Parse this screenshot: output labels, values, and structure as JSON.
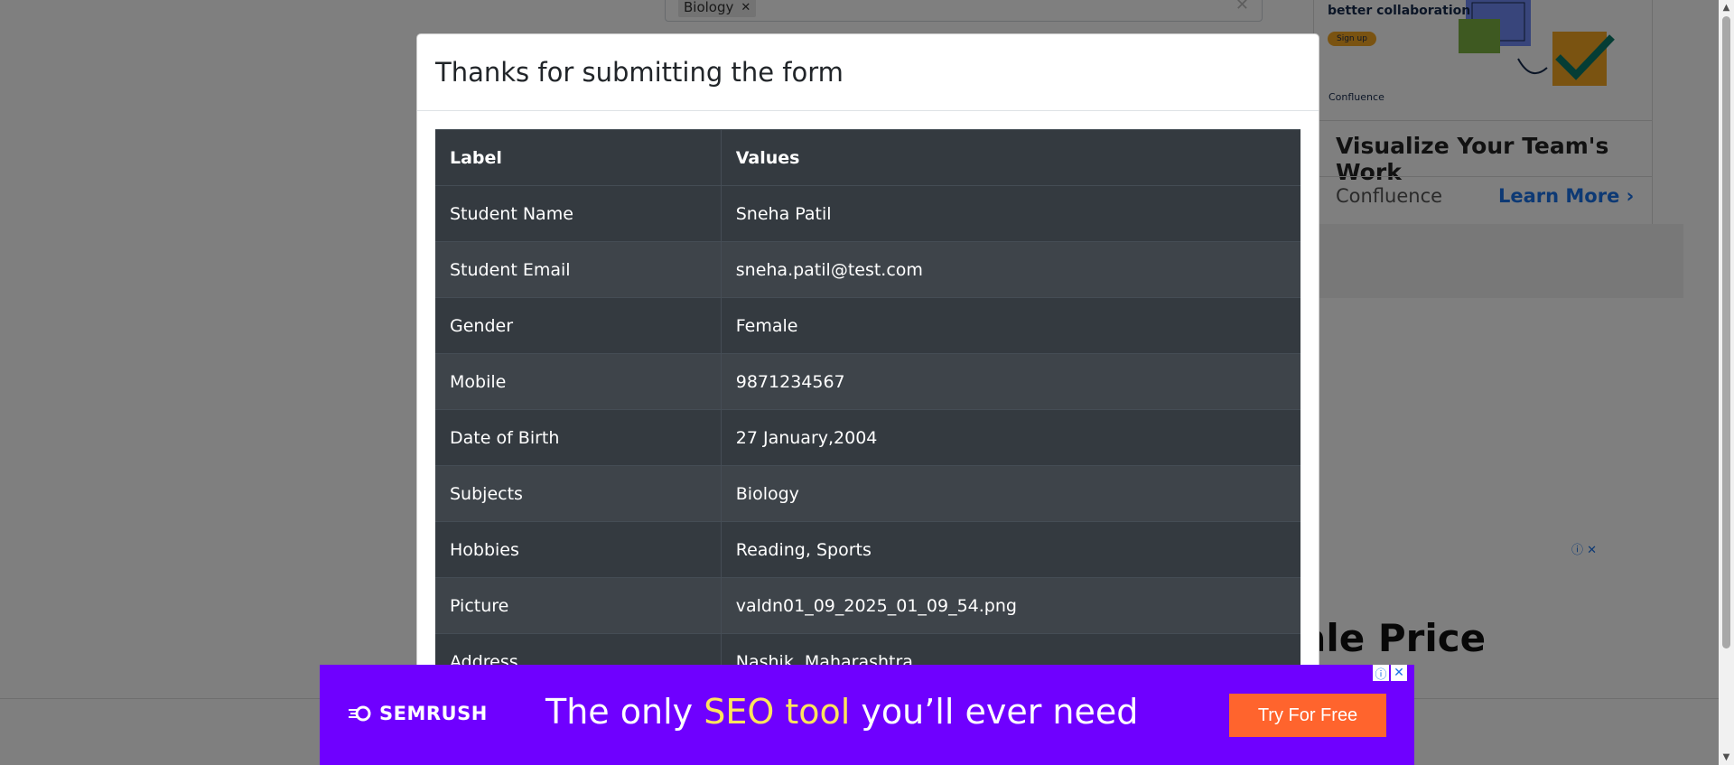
{
  "background": {
    "subject_chip": "Biology",
    "chip_remove_icon": "close-icon",
    "clear_icon": "close-icon",
    "ad_card": {
      "collab_text": "better collaboration",
      "signup": "Sign up",
      "logo_text": "Confluence",
      "headline": "Visualize Your Team's Work",
      "brand": "Confluence",
      "learn_more": "Learn More"
    },
    "sale_text": "ale Price"
  },
  "modal": {
    "title": "Thanks for submitting the form",
    "table": {
      "headers": [
        "Label",
        "Values"
      ],
      "rows": [
        {
          "label": "Student Name",
          "value": "Sneha Patil"
        },
        {
          "label": "Student Email",
          "value": "sneha.patil@test.com"
        },
        {
          "label": "Gender",
          "value": "Female"
        },
        {
          "label": "Mobile",
          "value": "9871234567"
        },
        {
          "label": "Date of Birth",
          "value": "27 January,2004"
        },
        {
          "label": "Subjects",
          "value": "Biology"
        },
        {
          "label": "Hobbies",
          "value": "Reading, Sports"
        },
        {
          "label": "Picture",
          "value": "valdn01_09_2025_01_09_54.png"
        },
        {
          "label": "Address",
          "value": "Nashik, Maharashtra"
        }
      ]
    }
  },
  "banner_ad": {
    "logo": "SEMRUSH",
    "tagline_pre": "The only ",
    "tagline_highlight": "SEO tool",
    "tagline_post": " you’ll ever need",
    "cta": "Try For Free",
    "colors": {
      "background": "#6f00ff",
      "highlight": "#ffe45c",
      "cta": "#ff642d"
    }
  },
  "colors": {
    "table_dark": "#343a40",
    "table_stripe": "#3e444a",
    "backdrop": "rgba(0,0,0,0.5)"
  }
}
